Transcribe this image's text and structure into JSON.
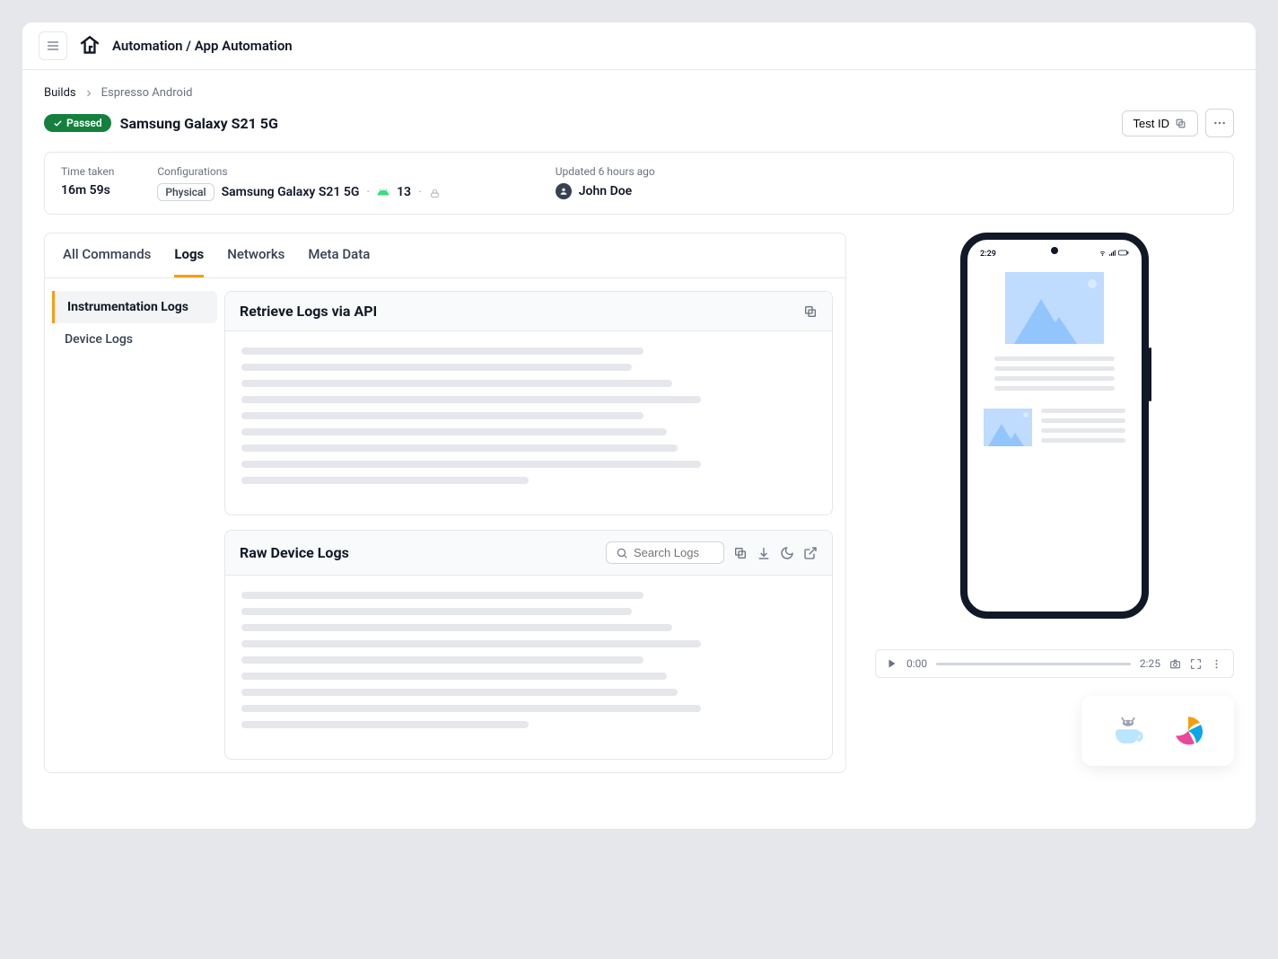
{
  "header": {
    "breadcrumb_root": "Automation",
    "breadcrumb_sub": "App Automation"
  },
  "crumbs": {
    "builds": "Builds",
    "current": "Espresso Android"
  },
  "title": {
    "status": "Passed",
    "device": "Samsung Galaxy S21 5G",
    "test_id_label": "Test ID"
  },
  "meta": {
    "time_label": "Time taken",
    "time_value": "16m 59s",
    "config_label": "Configurations",
    "config_chip": "Physical",
    "config_device": "Samsung Galaxy S21 5G",
    "config_os": "13",
    "updated_label": "Updated 6 hours ago",
    "user_name": "John Doe"
  },
  "tabs": {
    "all": "All Commands",
    "logs": "Logs",
    "networks": "Networks",
    "meta": "Meta Data"
  },
  "side": {
    "instrumentation": "Instrumentation Logs",
    "device": "Device Logs"
  },
  "cards": {
    "api_title": "Retrieve Logs via API",
    "raw_title": "Raw Device Logs",
    "search_placeholder": "Search Logs"
  },
  "phone": {
    "time": "2:29"
  },
  "player": {
    "current": "0:00",
    "total": "2:25"
  }
}
